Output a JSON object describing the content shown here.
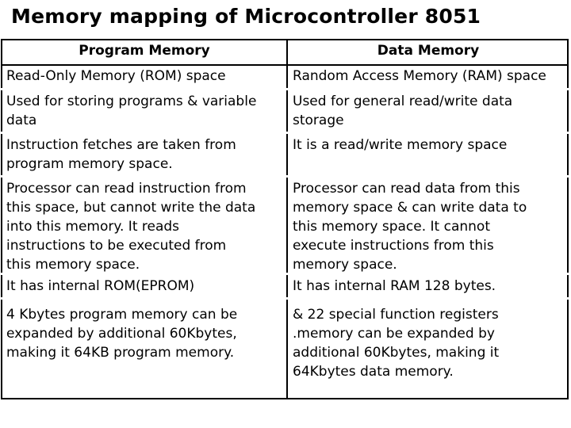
{
  "title": "Memory mapping of Microcontroller 8051",
  "table": {
    "headers": [
      "Program Memory",
      "Data Memory"
    ],
    "rows": [
      {
        "program": "Read-Only Memory (ROM) space",
        "data": "Random Access Memory (RAM) space"
      },
      {
        "program": "Used for storing programs & variable\ndata",
        "data": "Used for general read/write data\nstorage"
      },
      {
        "program": "Instruction fetches are taken from\nprogram memory space.",
        "data": "It is a read/write memory space"
      },
      {
        "program": "Processor can read instruction from\nthis space, but cannot write the data\ninto this memory. It reads\ninstructions to be executed from\nthis memory space.",
        "data": "Processor can read data from this\nmemory space & can write data to\nthis memory space. It cannot\nexecute instructions from this\nmemory space."
      },
      {
        "program": "It has internal ROM(EPROM)",
        "data": "It has internal RAM 128 bytes."
      },
      {
        "program": "4 Kbytes program memory can be\nexpanded by additional 60Kbytes,\nmaking it 64KB program memory.",
        "data": "&  22 special function registers\n.memory can be expanded by\nadditional 60Kbytes, making it\n64Kbytes data memory."
      }
    ]
  }
}
